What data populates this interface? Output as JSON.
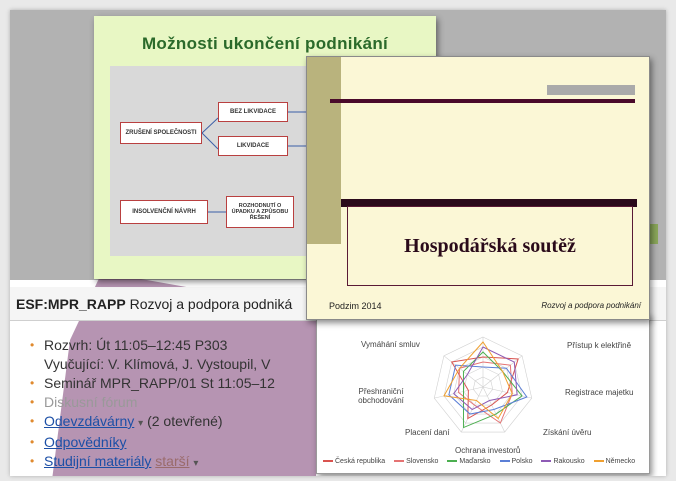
{
  "course": {
    "code": "ESF:MPR_RAPP",
    "name": "Rozvoj a podpora podniká"
  },
  "items": {
    "schedule": "Rozvrh: Út 11:05–12:45 P303",
    "teachers": "Vyučující: V. Klímová, J. Vystoupil, V",
    "seminar": "Seminář MPR_RAPP/01 St 11:05–12",
    "forum": "Diskusní fórum",
    "dropbox_link": "Odevzdávárny",
    "dropbox_note": "(2 otevřené)",
    "answers": "Odpovědníky",
    "materials": "Studijní materiály",
    "older": "starší"
  },
  "slide1": {
    "title": "Možnosti ukončení podnikání",
    "boxes": {
      "zruseni": "ZRUŠENÍ SPOLEČNOSTI",
      "bez_likvidace": "BEZ LIKVIDACE",
      "likvidace": "LIKVIDACE",
      "insolvencni": "INSOLVENČNÍ NÁVRH",
      "rozhodnuti": "ROZHODNUTÍ O ÚPADKU A ZPŮSOBU ŘEŠENÍ"
    }
  },
  "slide2": {
    "title": "Hospodářská soutěž",
    "footer_left": "Podzim 2014",
    "footer_right": "Rozvoj a podpora podnikání"
  },
  "chart_data": {
    "type": "radar",
    "axes": [
      "Vymáhání smluv",
      "Přístup k elektřině",
      "Registrace majetku",
      "Získání úvěru",
      "Ochrana investorů",
      "Placení daní",
      "Přeshraniční obchodování"
    ],
    "series": [
      {
        "name": "Česká republika",
        "color": "#d9534f"
      },
      {
        "name": "Slovensko",
        "color": "#e57373"
      },
      {
        "name": "Maďarsko",
        "color": "#4caf50"
      },
      {
        "name": "Polsko",
        "color": "#5b7fd6"
      },
      {
        "name": "Rakousko",
        "color": "#8e5bb5"
      },
      {
        "name": "Německo",
        "color": "#f0a030"
      }
    ]
  }
}
